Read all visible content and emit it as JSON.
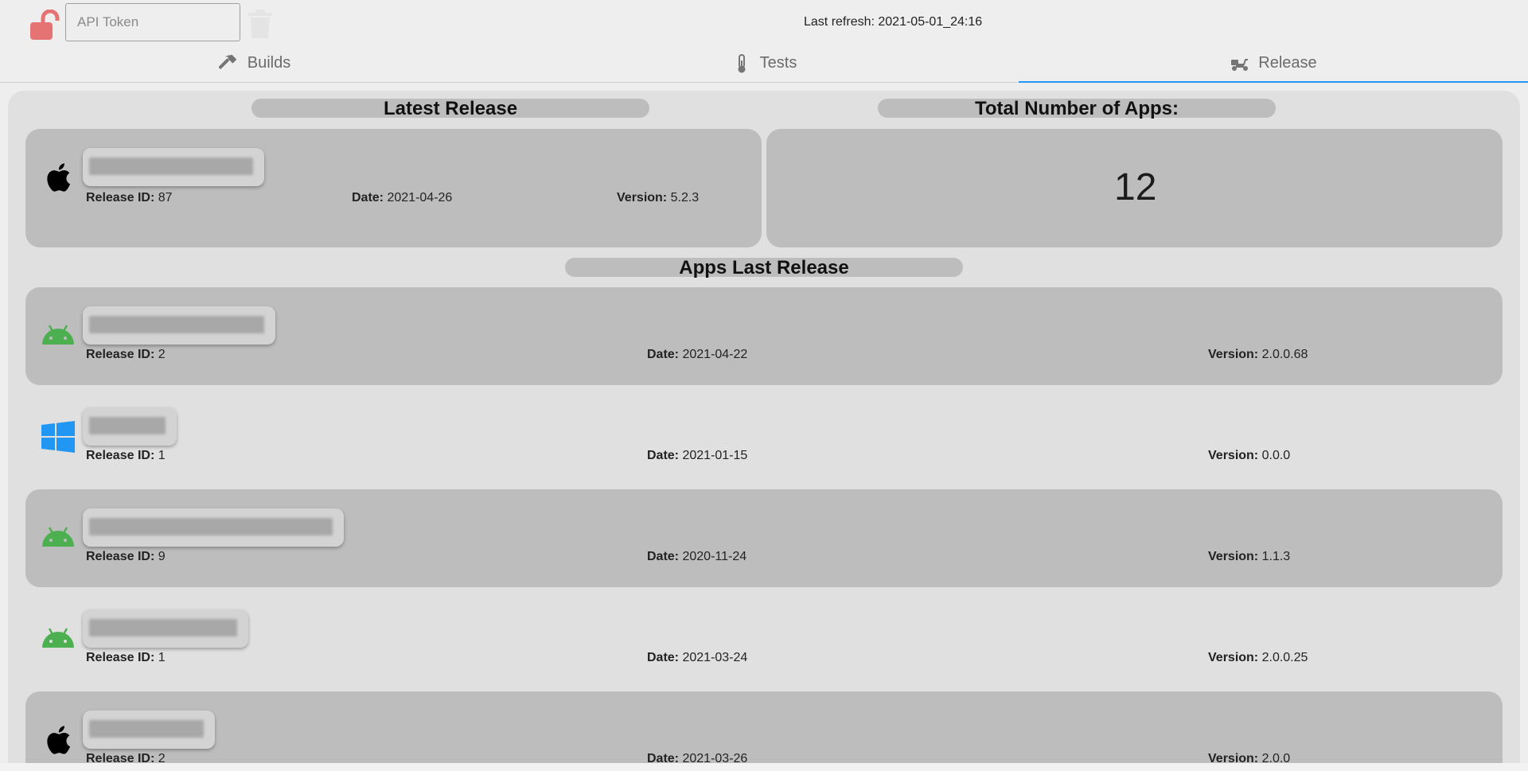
{
  "header": {
    "api_token_placeholder": "API Token",
    "last_refresh": "Last refresh: 2021-05-01_24:16"
  },
  "tabs": [
    {
      "label": "Builds",
      "icon": "hammer-icon",
      "active": false
    },
    {
      "label": "Tests",
      "icon": "thermometer-icon",
      "active": false
    },
    {
      "label": "Release",
      "icon": "delivery-scooter-icon",
      "active": true
    }
  ],
  "colors": {
    "accent": "#2196f3",
    "lock": "#e57373",
    "android": "#4caf50",
    "windows": "#2196f3",
    "card": "#bdbdbd",
    "panel": "#e0e0e0"
  },
  "labels": {
    "release_id": "Release ID:",
    "date": "Date:",
    "version": "Version:"
  },
  "latest_release": {
    "title": "Latest Release",
    "platform": "apple",
    "release_id": "87",
    "date": "2021-04-26",
    "version": "5.2.3"
  },
  "total_apps": {
    "title": "Total Number of Apps:",
    "count": "12"
  },
  "apps_last_release": {
    "title": "Apps Last Release",
    "items": [
      {
        "platform": "android",
        "release_id": "2",
        "date": "2021-04-22",
        "version": "2.0.0.68"
      },
      {
        "platform": "windows",
        "release_id": "1",
        "date": "2021-01-15",
        "version": "0.0.0"
      },
      {
        "platform": "android",
        "release_id": "9",
        "date": "2020-11-24",
        "version": "1.1.3"
      },
      {
        "platform": "android",
        "release_id": "1",
        "date": "2021-03-24",
        "version": "2.0.0.25"
      },
      {
        "platform": "apple",
        "release_id": "2",
        "date": "2021-03-26",
        "version": "2.0.0"
      }
    ]
  }
}
